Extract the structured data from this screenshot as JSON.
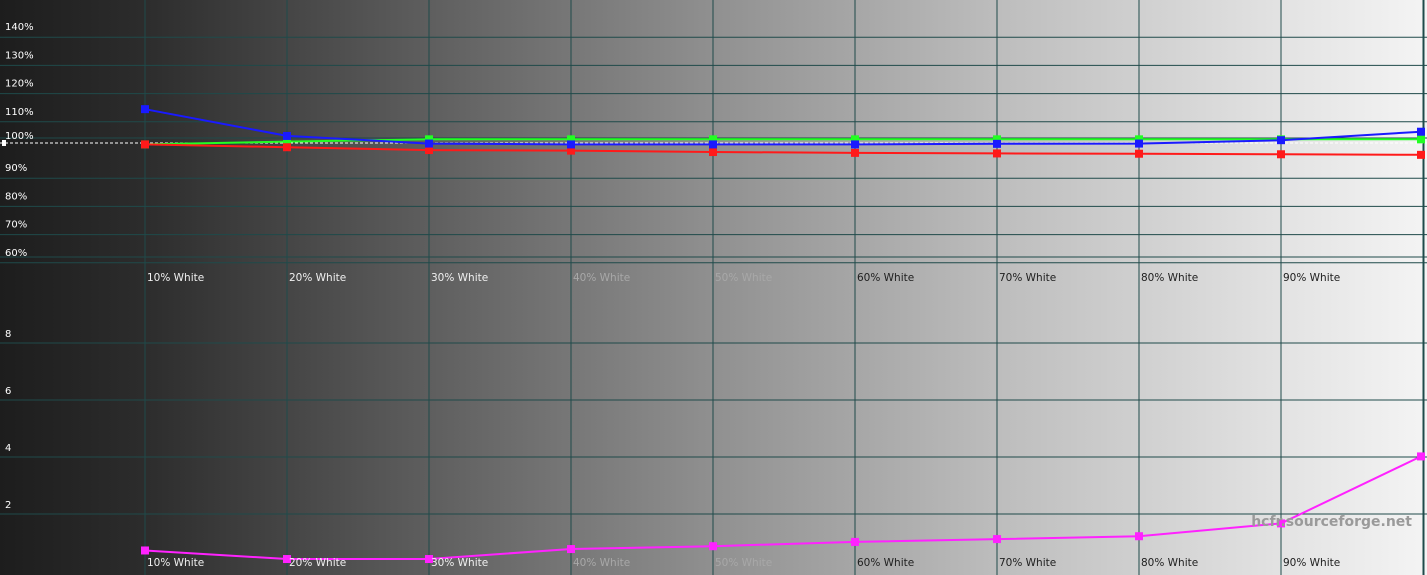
{
  "watermark": "hcfr.sourceforge.net",
  "colors": {
    "grid": "#1f4a4a",
    "red": "#ff1a1a",
    "green": "#22ff22",
    "blue": "#1a1aff",
    "magenta": "#ff22ff",
    "reference": "#ffffff"
  },
  "chart_data": [
    {
      "type": "line",
      "title": "",
      "xlabel": "",
      "ylabel": "",
      "categories": [
        "10% White",
        "20% White",
        "30% White",
        "40% White",
        "50% White",
        "60% White",
        "70% White",
        "80% White",
        "90% White",
        "100% White"
      ],
      "y_ticks": [
        "140%",
        "130%",
        "120%",
        "110%",
        "100%",
        "90%",
        "80%",
        "70%",
        "60%"
      ],
      "ylim": [
        55,
        145
      ],
      "reference_value": 100,
      "grid": true,
      "series": [
        {
          "name": "",
          "color": "red",
          "values": [
            99.5,
            98.5,
            97.5,
            97.3,
            96.8,
            96.5,
            96.3,
            96.2,
            96.0,
            95.8
          ]
        },
        {
          "name": "",
          "color": "green",
          "values": [
            99.5,
            100.5,
            101.3,
            101.3,
            101.3,
            101.3,
            101.3,
            101.3,
            101.3,
            101.3
          ]
        },
        {
          "name": "",
          "color": "blue",
          "values": [
            112.0,
            102.5,
            99.8,
            99.5,
            99.5,
            99.5,
            99.7,
            99.8,
            101.0,
            104.0
          ]
        }
      ]
    },
    {
      "type": "line",
      "title": "",
      "xlabel": "",
      "ylabel": "",
      "categories": [
        "10% White",
        "20% White",
        "30% White",
        "40% White",
        "50% White",
        "60% White",
        "70% White",
        "80% White",
        "90% White",
        "100% White"
      ],
      "y_ticks": [
        "8",
        "6",
        "4",
        "2"
      ],
      "ylim": [
        0,
        10
      ],
      "grid": true,
      "series": [
        {
          "name": "",
          "color": "magenta",
          "values": [
            0.65,
            0.35,
            0.35,
            0.7,
            0.8,
            0.95,
            1.05,
            1.15,
            1.6,
            3.95
          ]
        }
      ]
    }
  ]
}
